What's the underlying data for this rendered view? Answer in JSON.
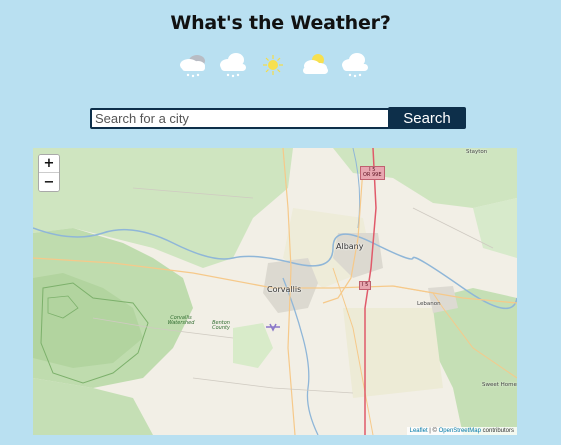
{
  "page": {
    "title": "What's the Weather?"
  },
  "forecast_icons": [
    {
      "name": "snow-cloud-icon"
    },
    {
      "name": "snow-cloud-icon"
    },
    {
      "name": "sun-icon"
    },
    {
      "name": "partly-cloudy-icon"
    },
    {
      "name": "snow-cloud-icon"
    }
  ],
  "search": {
    "placeholder": "Search for a city",
    "value": "",
    "button_label": "Search"
  },
  "map": {
    "zoom_in_label": "+",
    "zoom_out_label": "−",
    "attribution": {
      "leaflet": "Leaflet",
      "separator": " | © ",
      "osm": "OpenStreetMap",
      "suffix": " contributors"
    },
    "places": {
      "albany": "Albany",
      "corvallis": "Corvallis",
      "lebanon": "Lebanon",
      "stayton": "Stayton",
      "sweet_home": "Sweet Home",
      "corvallis_watershed": "Corvallis Watershed",
      "benton_county": "Benton County"
    },
    "shields": {
      "i5_top": "I 5",
      "or99e": "OR 99E",
      "i5_mid": "I 5"
    }
  },
  "colors": {
    "background": "#b9e0f1",
    "accent": "#0d2f4a"
  }
}
